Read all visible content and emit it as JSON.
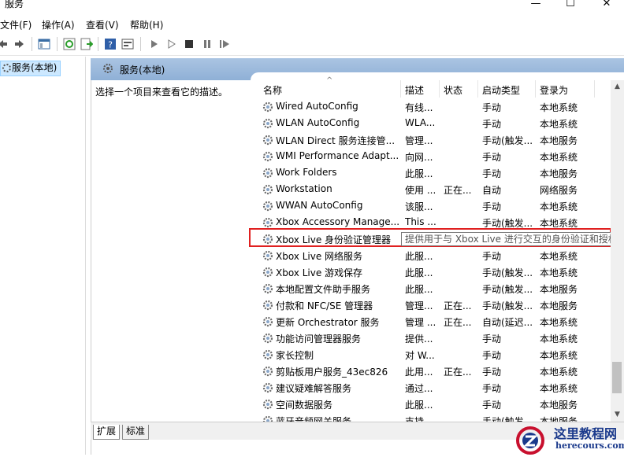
{
  "window": {
    "title": "服务",
    "minimize": "—",
    "maximize": "☐",
    "close": "✕"
  },
  "menu": [
    "文件(F)",
    "操作(A)",
    "查看(V)",
    "帮助(H)"
  ],
  "tree": {
    "item": "服务(本地)"
  },
  "panel": {
    "title": "服务(本地)",
    "description": "选择一个项目来查看它的描述。"
  },
  "columns": {
    "name": "名称",
    "desc": "描述",
    "status": "状态",
    "startup": "启动类型",
    "logon": "登录为"
  },
  "rows": [
    {
      "name": "Wired AutoConfig",
      "desc": "有线...",
      "status": "",
      "startup": "手动",
      "logon": "本地系统"
    },
    {
      "name": "WLAN AutoConfig",
      "desc": "WLA...",
      "status": "",
      "startup": "手动",
      "logon": "本地系统"
    },
    {
      "name": "WLAN Direct 服务连接管...",
      "desc": "管理...",
      "status": "",
      "startup": "手动(触发...",
      "logon": "本地服务"
    },
    {
      "name": "WMI Performance Adapt...",
      "desc": "向网...",
      "status": "",
      "startup": "手动",
      "logon": "本地系统"
    },
    {
      "name": "Work Folders",
      "desc": "此服...",
      "status": "",
      "startup": "手动",
      "logon": "本地服务"
    },
    {
      "name": "Workstation",
      "desc": "使用 ...",
      "status": "正在...",
      "startup": "自动",
      "logon": "网络服务"
    },
    {
      "name": "WWAN AutoConfig",
      "desc": "该服...",
      "status": "",
      "startup": "手动",
      "logon": "本地系统"
    },
    {
      "name": "Xbox Accessory Manage...",
      "desc": "This ...",
      "status": "",
      "startup": "手动(触发...",
      "logon": "本地系统"
    },
    {
      "name": "Xbox Live 身份验证管理器",
      "desc": "提",
      "status": "",
      "startup": "",
      "logon": ""
    },
    {
      "name": "Xbox Live 网络服务",
      "desc": "此服...",
      "status": "",
      "startup": "手动",
      "logon": "本地系统"
    },
    {
      "name": "Xbox Live 游戏保存",
      "desc": "此服...",
      "status": "",
      "startup": "手动(触发...",
      "logon": "本地系统"
    },
    {
      "name": "本地配置文件助手服务",
      "desc": "此服...",
      "status": "",
      "startup": "手动(触发...",
      "logon": "本地服务"
    },
    {
      "name": "付款和 NFC/SE 管理器",
      "desc": "管理...",
      "status": "正在...",
      "startup": "手动(触发...",
      "logon": "本地服务"
    },
    {
      "name": "更新 Orchestrator 服务",
      "desc": "管理 ...",
      "status": "正在...",
      "startup": "自动(延迟...",
      "logon": "本地系统"
    },
    {
      "name": "功能访问管理器服务",
      "desc": "提供...",
      "status": "",
      "startup": "手动",
      "logon": "本地系统"
    },
    {
      "name": "家长控制",
      "desc": "对 W...",
      "status": "",
      "startup": "手动",
      "logon": "本地系统"
    },
    {
      "name": "剪贴板用户服务_43ec826",
      "desc": "此用...",
      "status": "正在...",
      "startup": "手动",
      "logon": "本地系统"
    },
    {
      "name": "建议疑难解答服务",
      "desc": "通过...",
      "status": "",
      "startup": "手动",
      "logon": "本地系统"
    },
    {
      "name": "空间数据服务",
      "desc": "此服...",
      "status": "",
      "startup": "手动",
      "logon": "本地服务"
    },
    {
      "name": "蓝牙音频网关服务",
      "desc": "支持...",
      "status": "",
      "startup": "手动(触发...",
      "logon": "本地服务"
    }
  ],
  "tooltip": "提供用于与 Xbox Live 进行交互的身份验证和授权服务",
  "tabs": [
    "扩展",
    "标准"
  ],
  "watermark": {
    "title": "这里教程网",
    "url": "herecours.com"
  }
}
